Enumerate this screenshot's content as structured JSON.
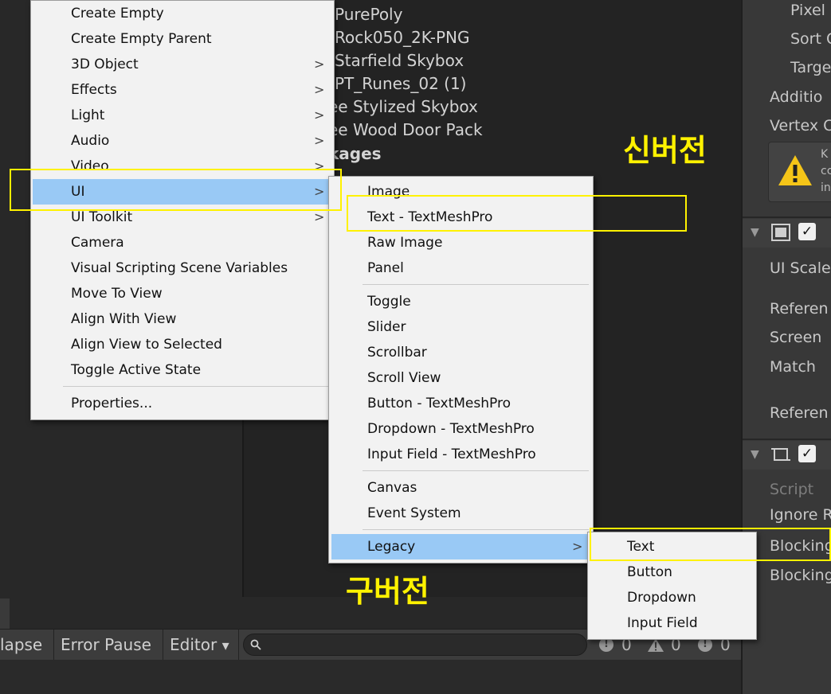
{
  "project_list": {
    "items": [
      "PurePoly",
      "Rock050_2K-PNG",
      "Starfield Skybox",
      "PT_Runes_02 (1)",
      "ee Stylized Skybox",
      "ee Wood Door Pack"
    ],
    "section_header": "kages"
  },
  "inspector": {
    "labels_top": [
      "Pixel",
      "Sort C",
      "Targe",
      "Additio",
      "Vertex C"
    ],
    "warning_lines": [
      "K",
      "cc",
      "in"
    ],
    "component1_labels": [
      "UI Scale",
      "Referen",
      "Screen",
      "Match",
      "Referen"
    ],
    "script_label": "Script",
    "component2_labels": [
      "Ignore R",
      "Blocking",
      "Blocking"
    ]
  },
  "console": {
    "collapse_label": "lapse",
    "error_pause_label": "Error Pause",
    "editor_label": "Editor",
    "editor_arrow": "▾",
    "search_placeholder": "",
    "log_count": "0",
    "warning_count": "0",
    "error_count": "0"
  },
  "main_menu": {
    "items": [
      "Create Empty",
      "Create Empty Parent",
      "3D Object",
      "Effects",
      "Light",
      "Audio",
      "Video",
      "UI",
      "UI Toolkit",
      "Camera",
      "Visual Scripting Scene Variables",
      "Move To View",
      "Align With View",
      "Align View to Selected",
      "Toggle Active State",
      "Properties..."
    ],
    "arrow": ">"
  },
  "ui_submenu": {
    "items": [
      "Image",
      "Text - TextMeshPro",
      "Raw Image",
      "Panel",
      "Toggle",
      "Slider",
      "Scrollbar",
      "Scroll View",
      "Button - TextMeshPro",
      "Dropdown - TextMeshPro",
      "Input Field - TextMeshPro",
      "Canvas",
      "Event System",
      "Legacy"
    ]
  },
  "legacy_submenu": {
    "items": [
      "Text",
      "Button",
      "Dropdown",
      "Input Field"
    ]
  },
  "annotations": {
    "new_version": "신버전",
    "old_version": "구버전"
  },
  "colors": {
    "highlight": "#99c9f5",
    "annotation": "#fff200",
    "menu_bg": "#f2f2f2"
  }
}
